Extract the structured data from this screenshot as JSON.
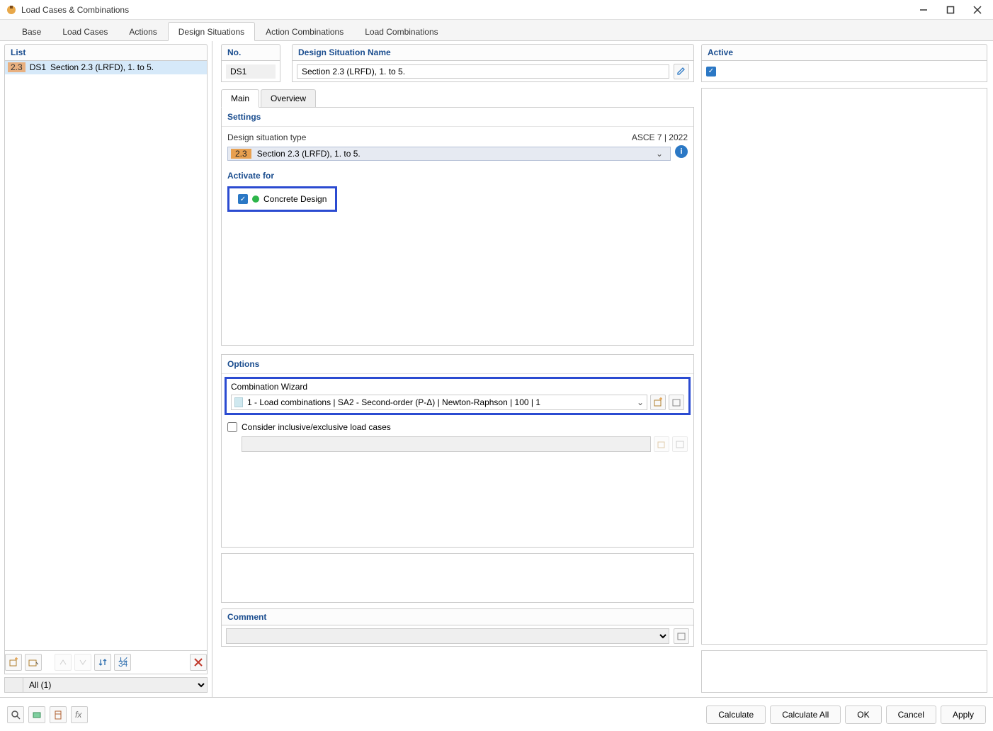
{
  "window": {
    "title": "Load Cases & Combinations"
  },
  "tabs": {
    "base": "Base",
    "loadcases": "Load Cases",
    "actions": "Actions",
    "designsituations": "Design Situations",
    "actioncombinations": "Action Combinations",
    "loadcombinations": "Load Combinations"
  },
  "list": {
    "header": "List",
    "items": [
      {
        "badge": "2.3",
        "ds": "DS1",
        "name": "Section 2.3 (LRFD), 1. to 5."
      }
    ],
    "filter": "All (1)"
  },
  "detail": {
    "no_label": "No.",
    "no_value": "DS1",
    "name_label": "Design Situation Name",
    "name_value": "Section 2.3 (LRFD), 1. to 5.",
    "active_label": "Active",
    "active_checked": true
  },
  "subtabs": {
    "main": "Main",
    "overview": "Overview"
  },
  "settings": {
    "title": "Settings",
    "type_label": "Design situation type",
    "standard": "ASCE 7 | 2022",
    "type_badge": "2.3",
    "type_text": "Section 2.3 (LRFD), 1. to 5."
  },
  "activate": {
    "title": "Activate for",
    "concrete": "Concrete Design"
  },
  "options": {
    "title": "Options",
    "wizard_label": "Combination Wizard",
    "wizard_value": "1 - Load combinations | SA2 - Second-order (P-Δ) | Newton-Raphson | 100 | 1",
    "consider_label": "Consider inclusive/exclusive load cases"
  },
  "comment": {
    "label": "Comment"
  },
  "footer": {
    "calculate": "Calculate",
    "calculate_all": "Calculate All",
    "ok": "OK",
    "cancel": "Cancel",
    "apply": "Apply"
  }
}
